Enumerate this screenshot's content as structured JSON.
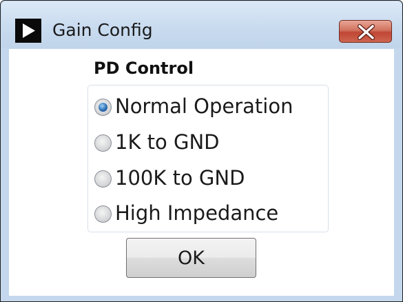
{
  "window": {
    "title": "Gain Config",
    "icon": "play-triangle-icon",
    "close_icon": "close-x-icon"
  },
  "group": {
    "label": "PD Control",
    "options": [
      {
        "label": "Normal Operation",
        "selected": true
      },
      {
        "label": "1K to GND",
        "selected": false
      },
      {
        "label": "100K to GND",
        "selected": false
      },
      {
        "label": "High Impedance",
        "selected": false
      }
    ]
  },
  "buttons": {
    "ok_label": "OK"
  }
}
